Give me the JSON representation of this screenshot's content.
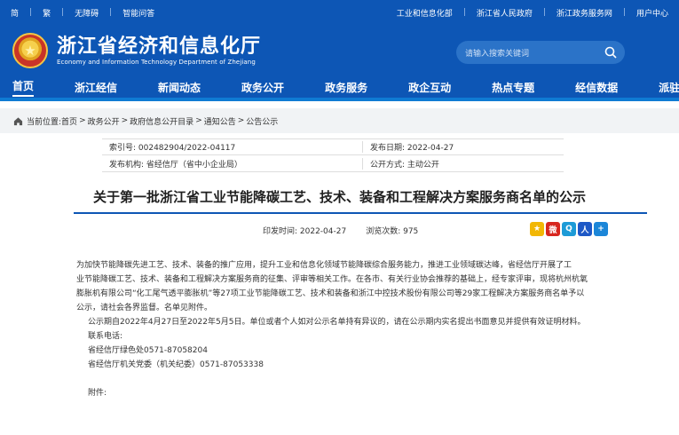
{
  "topbar": {
    "left": [
      "简",
      "繁",
      "无障碍",
      "智能问答"
    ],
    "right": [
      "工业和信息化部",
      "浙江省人民政府",
      "浙江政务服务网",
      "用户中心"
    ]
  },
  "header": {
    "title_cn": "浙江省经济和信息化厅",
    "title_en": "Economy and Information Technology Department of Zhejiang",
    "search_placeholder": "请输入搜索关键词"
  },
  "nav": [
    "首页",
    "浙江经信",
    "新闻动态",
    "政务公开",
    "政务服务",
    "政企互动",
    "热点专题",
    "经信数据",
    "派驻监督"
  ],
  "breadcrumb": {
    "prefix": "当前位置:",
    "items": [
      "首页",
      "政务公开",
      "政府信息公开目录",
      "通知公告",
      "公告公示"
    ]
  },
  "meta": {
    "index_no": "索引号: 002482904/2022-04117",
    "pub_date": "发布日期: 2022-04-27",
    "org": "发布机构: 省经信厅（省中小企业局）",
    "method": "公开方式: 主动公开"
  },
  "article": {
    "title": "关于第一批浙江省工业节能降碳工艺、技术、装备和工程解决方案服务商名单的公示",
    "print_date": "印发时间: 2022-04-27",
    "views": "浏览次数: 975",
    "p1_l1": "为加快节能降碳先进工艺、技术、装备的推广应用，提升工业和信息化领域节能降碳综合服务能力，推进工业领域碳达峰，省经信厅开展了工",
    "p1_l2": "业节能降碳工艺、技术、装备和工程解决方案服务商的征集、评审等相关工作。在各市、有关行业协会推荐的基础上，经专家评审，现将杭州杭氧",
    "p1_l3": "膨胀机有限公司“化工尾气透平膨胀机”等27项工业节能降碳工艺、技术和装备和浙江中控技术股份有限公司等29家工程解决方案服务商名单予以",
    "p1_l4": "公示，请社会各界监督。名单见附件。",
    "p2": "公示期自2022年4月27日至2022年5月5日。单位或者个人如对公示名单持有异议的，请在公示期内实名提出书面意见并提供有效证明材料。",
    "contact_label": "联系电话:",
    "contact1": "省经信厅绿色处0571-87058204",
    "contact2": "省经信厅机关党委（机关纪委）0571-87053338",
    "attachment_label": "附件:"
  }
}
